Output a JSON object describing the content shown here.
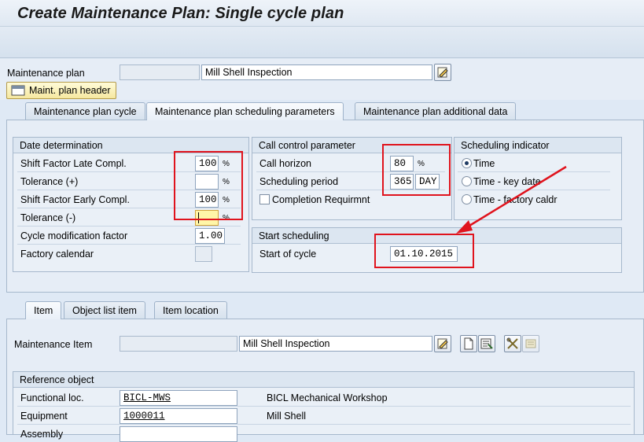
{
  "window": {
    "title": "Create Maintenance Plan: Single cycle plan"
  },
  "header": {
    "maintenance_plan_label": "Maintenance plan",
    "maintenance_plan_number": "",
    "maintenance_plan_text": "Mill Shell Inspection",
    "header_button_label": "Maint. plan header"
  },
  "top_tabs": [
    {
      "label": "Maintenance plan cycle",
      "active": false
    },
    {
      "label": "Maintenance plan scheduling parameters",
      "active": true
    },
    {
      "label": "Maintenance plan additional data",
      "active": false
    }
  ],
  "date_determination": {
    "title": "Date determination",
    "rows": [
      {
        "label": "Shift Factor Late Compl.",
        "value": "100",
        "unit": "%"
      },
      {
        "label": "Tolerance (+)",
        "value": "",
        "unit": "%"
      },
      {
        "label": "Shift Factor Early Compl.",
        "value": "100",
        "unit": "%"
      },
      {
        "label": "Tolerance (-)",
        "value": "",
        "unit": "%"
      },
      {
        "label": "Cycle modification factor",
        "value": "1.00",
        "unit": ""
      },
      {
        "label": "Factory calendar",
        "value": "",
        "unit": ""
      }
    ]
  },
  "call_control": {
    "title": "Call control parameter",
    "call_horizon_label": "Call horizon",
    "call_horizon_value": "80",
    "call_horizon_unit": "%",
    "scheduling_period_label": "Scheduling period",
    "scheduling_period_value": "365",
    "scheduling_period_unit": "DAY",
    "completion_label": "Completion Requirmnt",
    "completion_checked": false
  },
  "scheduling_indicator": {
    "title": "Scheduling indicator",
    "options": [
      {
        "label": "Time",
        "selected": true
      },
      {
        "label": "Time - key date",
        "selected": false
      },
      {
        "label": "Time - factory caldr",
        "selected": false
      }
    ]
  },
  "start_scheduling": {
    "title": "Start scheduling",
    "start_of_cycle_label": "Start of cycle",
    "start_of_cycle_value": "01.10.2015"
  },
  "item_tabs": [
    {
      "label": "Item",
      "active": true
    },
    {
      "label": "Object list item",
      "active": false
    },
    {
      "label": "Item location",
      "active": false
    }
  ],
  "item": {
    "maintenance_item_label": "Maintenance Item",
    "maintenance_item_number": "",
    "maintenance_item_text": "Mill Shell Inspection"
  },
  "reference_object": {
    "title": "Reference object",
    "rows": [
      {
        "label": "Functional loc.",
        "value": "BICL-MWS",
        "description": "BICL Mechanical Workshop"
      },
      {
        "label": "Equipment",
        "value": "1000011",
        "description": "Mill Shell"
      },
      {
        "label": "Assembly",
        "value": "",
        "description": ""
      }
    ]
  },
  "colors": {
    "annotation_red": "#e0131d",
    "background": "#dfe9f5"
  }
}
